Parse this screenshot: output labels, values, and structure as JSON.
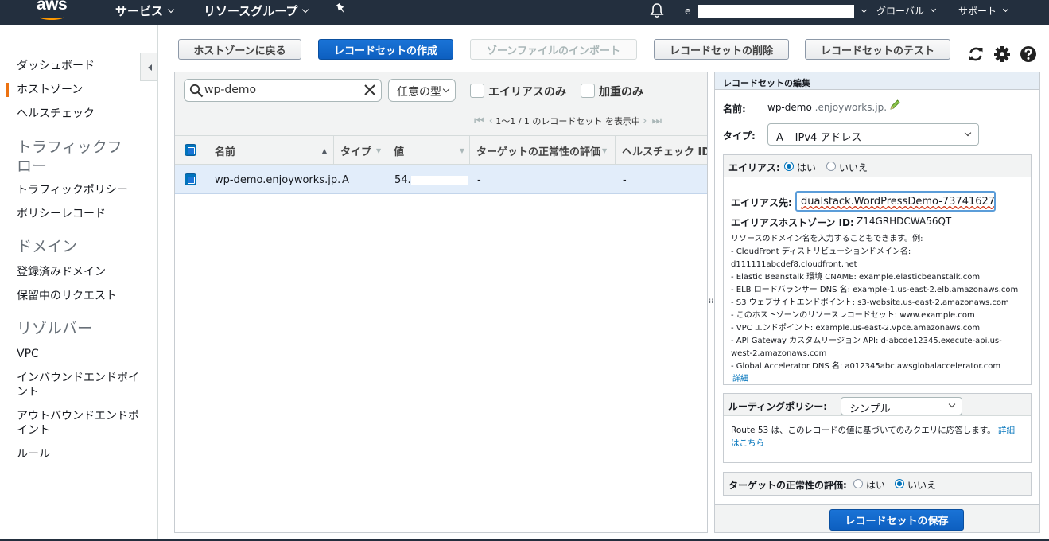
{
  "topnav": {
    "logo": "aws",
    "services": "サービス",
    "resource_groups": "リソースグループ",
    "account_initial": "e",
    "region": "グローバル",
    "support": "サポート"
  },
  "sidebar": {
    "items": [
      {
        "label": "ダッシュボード"
      },
      {
        "label": "ホストゾーン"
      },
      {
        "label": "ヘルスチェック"
      }
    ],
    "traffic_flow": {
      "title": "トラフィックフロー",
      "items": [
        {
          "label": "トラフィックポリシー"
        },
        {
          "label": "ポリシーレコード"
        }
      ]
    },
    "domains": {
      "title": "ドメイン",
      "items": [
        {
          "label": "登録済みドメイン"
        },
        {
          "label": "保留中のリクエスト"
        }
      ]
    },
    "resolver": {
      "title": "リゾルバー",
      "items": [
        {
          "label": "VPC"
        },
        {
          "label": "インバウンドエンドポイント"
        },
        {
          "label": "アウトバウンドエンドポイント"
        },
        {
          "label": "ルール"
        }
      ]
    }
  },
  "toolbar": {
    "back": "ホストゾーンに戻る",
    "create": "レコードセットの作成",
    "import": "ゾーンファイルのインポート",
    "delete": "レコードセットの削除",
    "test": "レコードセットのテスト"
  },
  "filter": {
    "search_value": "wp-demo",
    "type_select": "任意の型",
    "alias_only": "エイリアスのみ",
    "weighted_only": "加重のみ",
    "pager_text": "1～1 / 1 のレコードセット を表示中"
  },
  "table": {
    "headers": [
      "名前",
      "タイプ",
      "値",
      "ターゲットの正常性の評価",
      "ヘルスチェック ID"
    ],
    "rows": [
      {
        "name": "wp-demo.enjoyworks.jp.",
        "type": "A",
        "value": "54.",
        "evaluate": "-",
        "health_check": "-"
      }
    ]
  },
  "edit": {
    "title": "レコードセットの編集",
    "name_label": "名前:",
    "name_value": "wp-demo",
    "name_suffix": ".enjoyworks.jp.",
    "type_label": "タイプ:",
    "type_value": "A – IPv4 アドレス",
    "alias_label": "エイリアス:",
    "alias_yes": "はい",
    "alias_no": "いいえ",
    "alias_target_label": "エイリアス先:",
    "alias_target_value": "dualstack.WordPressDemo-73741627",
    "alias_zone_label": "エイリアスホストゾーン ID:",
    "alias_zone_value": "Z14GRHDCWA56QT",
    "help_lines": [
      "リソースのドメイン名を入力することもできます。例:",
      "-  CloudFront ディストリビューションドメイン名:",
      "d111111abcdef8.cloudfront.net",
      "-  Elastic Beanstalk 環境 CNAME: example.elasticbeanstalk.com",
      "-  ELB ロードバランサー DNS 名: example-1.us-east-2.elb.amazonaws.com",
      "-  S3 ウェブサイトエンドポイント: s3-website.us-east-2.amazonaws.com",
      "-  このホストゾーンのリソースレコードセット: www.example.com",
      "-  VPC エンドポイント: example.us-east-2.vpce.amazonaws.com",
      "-  API Gateway カスタムリージョン API: d-abcde12345.execute-api.us-",
      "west-2.amazonaws.com",
      "-  Global Accelerator DNS 名: a012345abc.awsglobalaccelerator.com"
    ],
    "help_more": "詳細",
    "routing_label": "ルーティングポリシー:",
    "routing_value": "シンプル",
    "routing_help": "Route 53 は、このレコードの値に基づいてのみクエリに応答します。",
    "routing_link_1": "詳細",
    "routing_link_2": "はこちら",
    "health_label": "ターゲットの正常性の評価:",
    "health_yes": "はい",
    "health_no": "いいえ",
    "save": "レコードセットの保存"
  },
  "colors": {
    "nav_bg": "#232f3e",
    "primary": "#1a73d6",
    "accent": "#ec7211",
    "row_selected": "#e2edfa"
  }
}
